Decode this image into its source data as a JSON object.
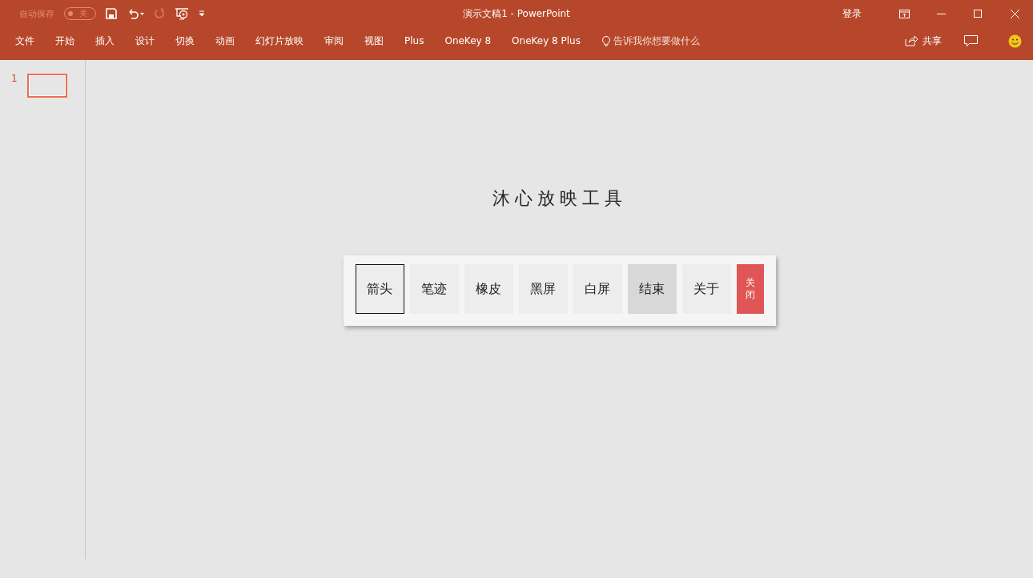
{
  "title_bar": {
    "autosave": {
      "label": "自动保存",
      "on": false,
      "state_text": "关"
    },
    "title": "演示文稿1  -  PowerPoint",
    "sign_in": "登录"
  },
  "ribbon_tabs": [
    {
      "label": "文件",
      "selected": false
    },
    {
      "label": "开始",
      "selected": false
    },
    {
      "label": "插入",
      "selected": false
    },
    {
      "label": "设计",
      "selected": false
    },
    {
      "label": "切换",
      "selected": false
    },
    {
      "label": "动画",
      "selected": false
    },
    {
      "label": "幻灯片放映",
      "selected": false
    },
    {
      "label": "审阅",
      "selected": false
    },
    {
      "label": "视图",
      "selected": false
    },
    {
      "label": "Plus",
      "selected": false
    },
    {
      "label": "OneKey 8",
      "selected": false
    },
    {
      "label": "OneKey 8 Plus",
      "selected": false
    }
  ],
  "tell_me": "告诉我你想要做什么",
  "share": "共享",
  "thumbnails": [
    {
      "number": "1",
      "selected": true
    }
  ],
  "slide": {
    "title": "沐心放映工具",
    "tools": [
      {
        "label": "箭头",
        "kind": "tool",
        "selected": true,
        "hovered": false
      },
      {
        "label": "笔迹",
        "kind": "tool",
        "selected": false,
        "hovered": false
      },
      {
        "label": "橡皮",
        "kind": "tool",
        "selected": false,
        "hovered": false
      },
      {
        "label": "黑屏",
        "kind": "tool",
        "selected": false,
        "hovered": false
      },
      {
        "label": "白屏",
        "kind": "tool",
        "selected": false,
        "hovered": false
      },
      {
        "label": "结束",
        "kind": "tool",
        "selected": false,
        "hovered": true
      },
      {
        "label": "关于",
        "kind": "tool",
        "selected": false,
        "hovered": false
      },
      {
        "label": "关闭",
        "kind": "close",
        "selected": false,
        "hovered": false
      }
    ]
  }
}
